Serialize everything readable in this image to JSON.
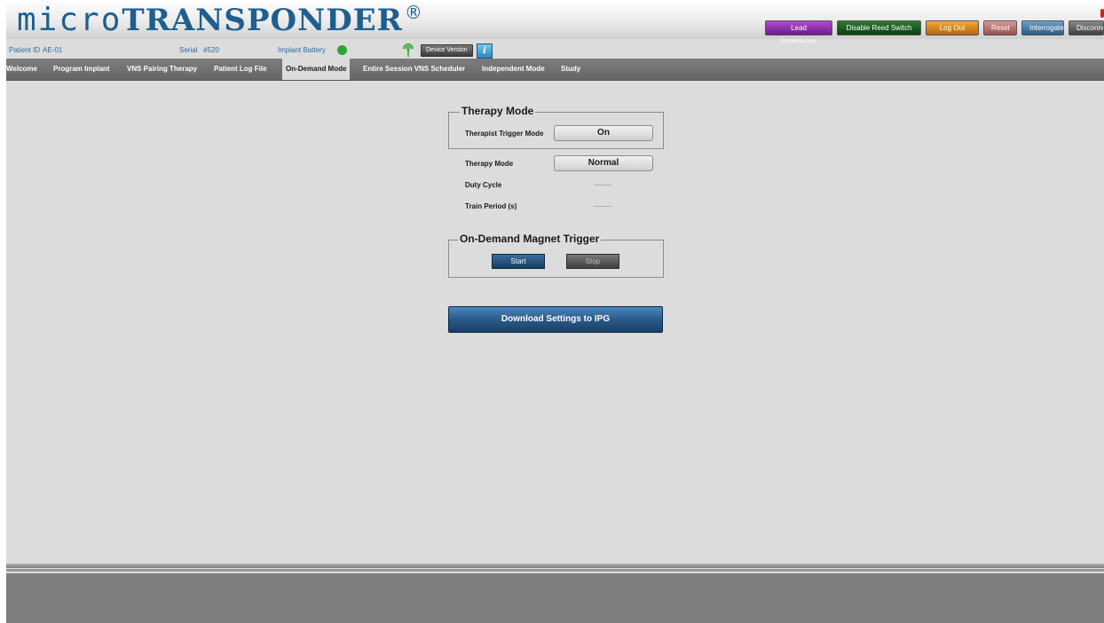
{
  "logo": {
    "micro": "micro",
    "brand": "TRANSPONDER",
    "reg": "®"
  },
  "top_buttons": {
    "lead_impedance": "Lead Impedance",
    "disable_reed": "Disable Reed Switch",
    "log_out": "Log Out",
    "reset": "Reset",
    "interrogate": "Interrogate",
    "disconnect": "Disconnect"
  },
  "info": {
    "patient_id_label": "Patient ID",
    "patient_id": "AE-01",
    "serial_label": "Serial",
    "serial": "#520",
    "battery_label": "Implant Battery",
    "battery_color": "#2fa82f",
    "device_version": "Device Version",
    "info_icon": "i"
  },
  "tabs": [
    {
      "label": "Welcome"
    },
    {
      "label": "Program Implant"
    },
    {
      "label": "VNS Pairing Therapy"
    },
    {
      "label": "Patient Log File"
    },
    {
      "label": "On-Demand Mode",
      "active": true
    },
    {
      "label": "Entire Session VNS Scheduler"
    },
    {
      "label": "Independent Mode"
    },
    {
      "label": "Study"
    }
  ],
  "therapy": {
    "legend": "Therapy Mode",
    "trigger_label": "Therapist Trigger Mode",
    "trigger_value": "On",
    "mode_label": "Therapy Mode",
    "mode_value": "Normal",
    "duty_label": "Duty Cycle",
    "train_label": "Train Period (s)"
  },
  "magnet": {
    "legend": "On-Demand Magnet Trigger",
    "start": "Start",
    "stop": "Stop"
  },
  "download": "Download Settings to IPG"
}
